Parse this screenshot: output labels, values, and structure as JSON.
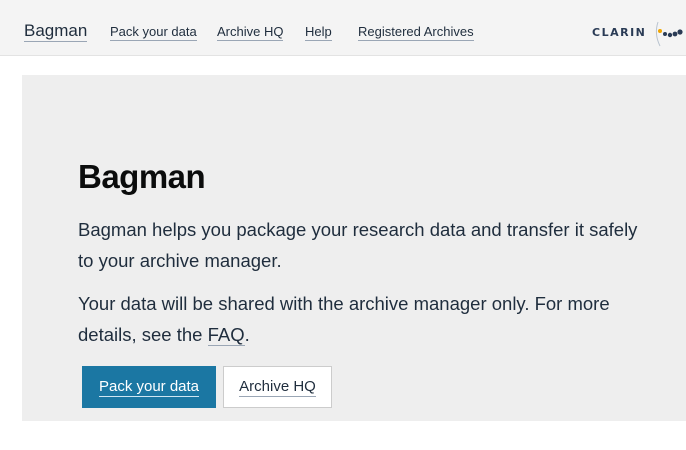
{
  "header": {
    "brand": "Bagman",
    "nav": [
      "Pack your data",
      "Archive HQ",
      "Help",
      "Registered Archives"
    ],
    "logo_text": "CLARIN"
  },
  "hero": {
    "title": "Bagman",
    "paragraph1": "Bagman helps you package your research data and transfer it safely to your archive manager.",
    "paragraph2_prefix": "Your data will be shared with the archive manager only. For more details, see the ",
    "faq_link": "FAQ",
    "paragraph2_suffix": ".",
    "primary_button": "Pack your data",
    "secondary_button": "Archive HQ"
  },
  "colors": {
    "primary": "#1b77a3",
    "hero_background": "#eeeeee",
    "header_background": "#f4f4f4"
  }
}
